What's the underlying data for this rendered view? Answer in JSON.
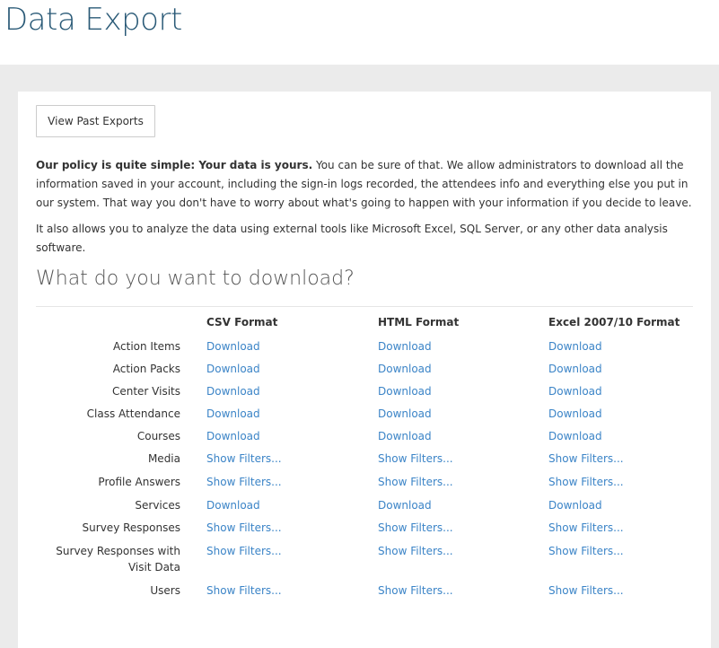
{
  "header": {
    "title": "Data Export"
  },
  "toolbar": {
    "past_exports_label": "View Past Exports"
  },
  "intro": {
    "bold": "Our policy is quite simple: Your data is yours.",
    "text1": " You can be sure of that. We allow administrators to download all the information saved in your account, including the sign-in logs recorded, the attendees info and everything else you put in our system. That way you don't have to worry about what's going to happen with your information if you decide to leave.",
    "text2": "It also allows you to analyze the data using external tools like Microsoft Excel, SQL Server, or any other data analysis software."
  },
  "download_section": {
    "title": "What do you want to download?",
    "columns": [
      "CSV Format",
      "HTML Format",
      "Excel 2007/10 Format"
    ],
    "rows": [
      {
        "label": "Action Items",
        "links": [
          "Download",
          "Download",
          "Download"
        ]
      },
      {
        "label": "Action Packs",
        "links": [
          "Download",
          "Download",
          "Download"
        ]
      },
      {
        "label": "Center Visits",
        "links": [
          "Download",
          "Download",
          "Download"
        ]
      },
      {
        "label": "Class Attendance",
        "links": [
          "Download",
          "Download",
          "Download"
        ]
      },
      {
        "label": "Courses",
        "links": [
          "Download",
          "Download",
          "Download"
        ]
      },
      {
        "label": "Media",
        "links": [
          "Show Filters...",
          "Show Filters...",
          "Show Filters..."
        ]
      },
      {
        "label": "Profile Answers",
        "links": [
          "Show Filters...",
          "Show Filters...",
          "Show Filters..."
        ]
      },
      {
        "label": "Services",
        "links": [
          "Download",
          "Download",
          "Download"
        ]
      },
      {
        "label": "Survey Responses",
        "links": [
          "Show Filters...",
          "Show Filters...",
          "Show Filters..."
        ]
      },
      {
        "label": "Survey Responses with Visit Data",
        "links": [
          "Show Filters...",
          "Show Filters...",
          "Show Filters..."
        ]
      },
      {
        "label": "Users",
        "links": [
          "Show Filters...",
          "Show Filters...",
          "Show Filters..."
        ]
      }
    ]
  },
  "colors": {
    "title": "#2a5a77",
    "link": "#3b84c7",
    "background": "#ebebeb"
  }
}
